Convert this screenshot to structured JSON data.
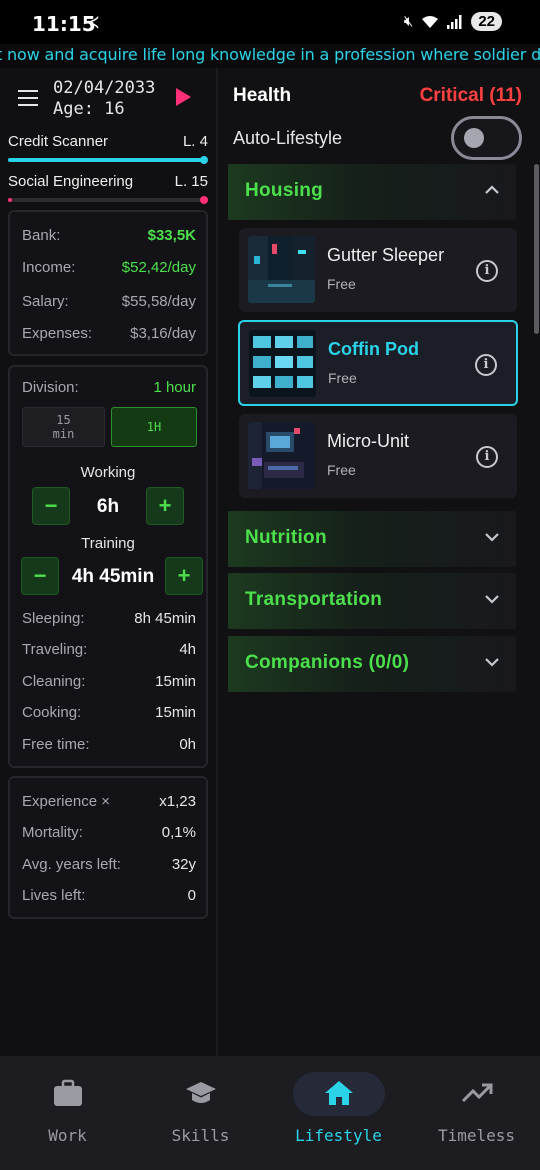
{
  "status_bar": {
    "time": "11:15",
    "battery": "22"
  },
  "ticker": {
    "text": "t now and acquire life long knowledge in a profession where soldier demand never"
  },
  "header": {
    "date": "02/04/2033",
    "age": "Age: 16"
  },
  "skills": [
    {
      "name": "Credit Scanner",
      "level": "L. 4",
      "progress": 1.0,
      "color": "#2ad3e8"
    },
    {
      "name": "Social Engineering",
      "level": "L. 15",
      "progress": 0.02,
      "color": "#ff2f7a"
    }
  ],
  "finance": {
    "bank_label": "Bank:",
    "bank_value": "$33,5K",
    "income_label": "Income:",
    "income_value": "$52,42/day",
    "salary_label": "Salary:",
    "salary_value": "$55,58/day",
    "expenses_label": "Expenses:",
    "expenses_value": "$3,16/day"
  },
  "schedule": {
    "division_label": "Division:",
    "division_value": "1 hour",
    "seg_a": "15\nmin",
    "seg_b": "1H",
    "working_label": "Working",
    "working_value": "6h",
    "training_label": "Training",
    "training_value": "4h 45min",
    "minus": "−",
    "plus": "+",
    "rows": [
      {
        "k": "Sleeping:",
        "v": "8h 45min"
      },
      {
        "k": "Traveling:",
        "v": "4h"
      },
      {
        "k": "Cleaning:",
        "v": "15min"
      },
      {
        "k": "Cooking:",
        "v": "15min"
      },
      {
        "k": "Free time:",
        "v": "0h"
      }
    ]
  },
  "stats": [
    {
      "k": "Experience ×",
      "v": "x1,23"
    },
    {
      "k": "Mortality:",
      "v": "0,1%"
    },
    {
      "k": "Avg. years left:",
      "v": "32y"
    },
    {
      "k": "Lives left:",
      "v": "0"
    }
  ],
  "right": {
    "health_label": "Health",
    "health_value": "Critical (11)",
    "auto_label": "Auto-Lifestyle"
  },
  "sections": {
    "housing": "Housing",
    "nutrition": "Nutrition",
    "transportation": "Transportation",
    "companions": "Companions (0/0)"
  },
  "housing_items": [
    {
      "name": "Gutter Sleeper",
      "price": "Free",
      "info": "i"
    },
    {
      "name": "Coffin Pod",
      "price": "Free",
      "info": "i"
    },
    {
      "name": "Micro-Unit",
      "price": "Free",
      "info": "i"
    }
  ],
  "nav": [
    {
      "label": "Work",
      "icon": "briefcase-icon"
    },
    {
      "label": "Skills",
      "icon": "graduation-cap-icon"
    },
    {
      "label": "Lifestyle",
      "icon": "home-icon"
    },
    {
      "label": "Timeless",
      "icon": "trending-up-icon"
    }
  ],
  "colors": {
    "accent": "#2ad3e8",
    "green": "#4ce04c",
    "pink": "#ff2f7a",
    "critical": "#ff4040"
  }
}
